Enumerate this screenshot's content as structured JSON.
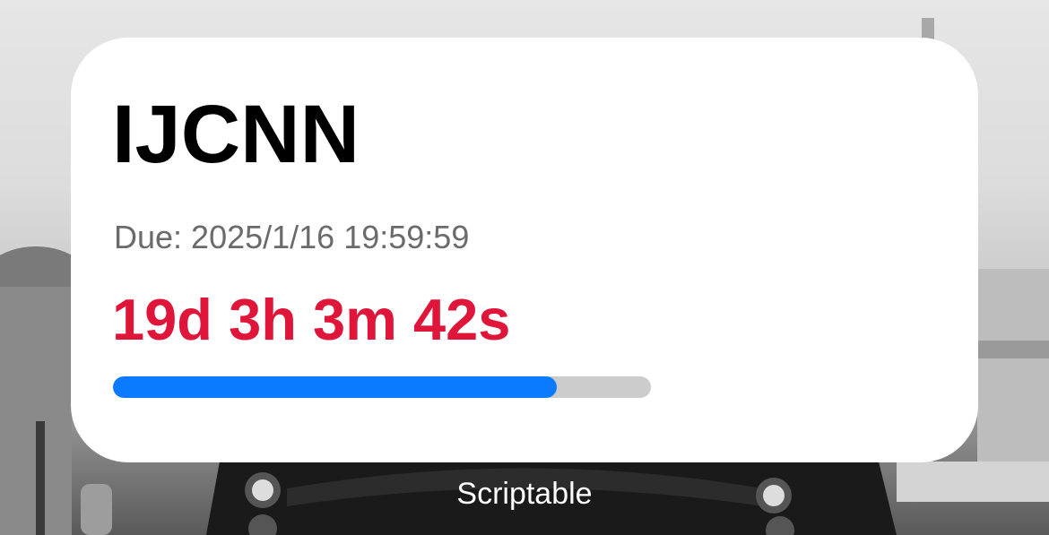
{
  "widget": {
    "title": "IJCNN",
    "due": "Due: 2025/1/16 19:59:59",
    "countdown": "19d 3h 3m 42s",
    "progress_fraction": 0.825,
    "colors": {
      "countdown": "#e0153a",
      "progress_fill": "#0a7bff",
      "progress_track": "#cccccc"
    }
  },
  "app_label": "Scriptable"
}
